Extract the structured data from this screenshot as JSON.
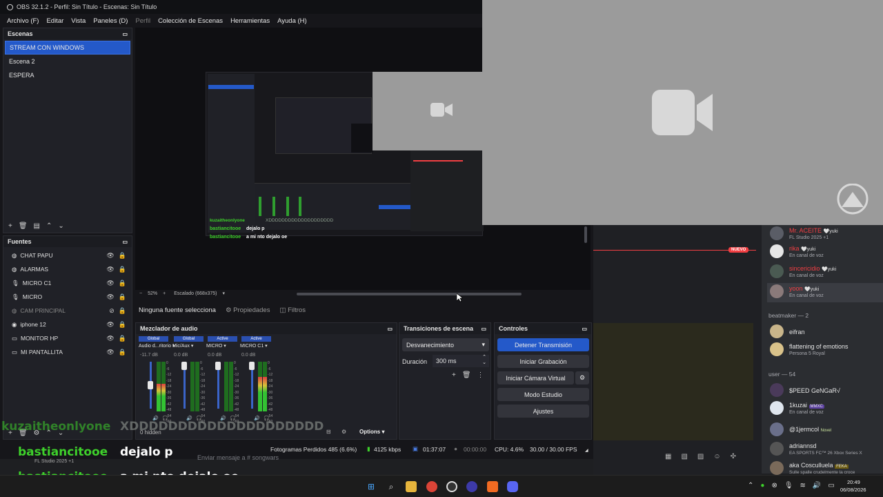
{
  "window": {
    "title": "OBS 32.1.2 - Perfil: Sin Título - Escenas: Sin Título",
    "menu": [
      "Archivo (F)",
      "Editar",
      "Vista",
      "Paneles (D)",
      "Perfil",
      "Colección de Escenas",
      "Herramientas",
      "Ayuda (H)"
    ]
  },
  "scenes": {
    "header": "Escenas",
    "items": [
      "STREAM CON WINDOWS",
      "Escena 2",
      "ESPERA"
    ],
    "selected_index": 0
  },
  "sources": {
    "header": "Fuentes",
    "items": [
      {
        "label": "CHAT PAPU",
        "icon": "browser-icon",
        "hidden": false
      },
      {
        "label": "ALARMAS",
        "icon": "browser-icon",
        "hidden": false
      },
      {
        "label": "MICRO C1",
        "icon": "mic-icon",
        "hidden": false
      },
      {
        "label": "MICRO",
        "icon": "mic-icon",
        "hidden": false
      },
      {
        "label": "CAM PRINCIPAL",
        "icon": "browser-icon",
        "hidden": true
      },
      {
        "label": "iphone 12",
        "icon": "camera-icon",
        "hidden": false
      },
      {
        "label": "MONITOR HP",
        "icon": "monitor-icon",
        "hidden": false
      },
      {
        "label": "MI PANTALLITA",
        "icon": "monitor-icon",
        "hidden": false
      }
    ]
  },
  "preview": {
    "zoom": "52%",
    "scale_label": "Escalado (668x375)",
    "no_source": "Ninguna fuente selecciona",
    "properties": "Propiedades",
    "filters": "Filtros",
    "nested_chat_line1_user": "bastiancitooe",
    "nested_chat_line1_msg": "dejalo p",
    "nested_chat_line2_user": "bastiancitooe",
    "nested_chat_line2_msg": "a mi nto dejalo oe",
    "nested_user_top": "kuzaitheonlyone",
    "nested_top_msg": "XDDDDDDDDDDDDDDDDDDDD"
  },
  "mixer": {
    "header": "Mezclador de audio",
    "channels": [
      {
        "badge": "Global",
        "name": "Audio d...ritorio",
        "db": "-11.7 dB",
        "level": 0.55
      },
      {
        "badge": "Global",
        "name": "Mic/Aux",
        "db": "0.0 dB",
        "level": 0.0
      },
      {
        "badge": "Active",
        "name": "MICRO",
        "db": "0.0 dB",
        "level": 0.0
      },
      {
        "badge": "Active",
        "name": "MICRO C1",
        "db": "0.0 dB",
        "level": 0.7
      }
    ],
    "scale": [
      "0",
      "-6",
      "-12",
      "-18",
      "-24",
      "-30",
      "-36",
      "-42",
      "-48",
      "-54",
      "-60"
    ],
    "hidden_label": "0 hidden",
    "options_label": "Options"
  },
  "transitions": {
    "header": "Transiciones de escena",
    "selected": "Desvanecimiento",
    "duration_label": "Duración",
    "duration_value": "300 ms"
  },
  "controls": {
    "header": "Controles",
    "stop_stream": "Detener Transmisión",
    "start_record": "Iniciar Grabación",
    "virtual_cam": "Iniciar Cámara Virtual",
    "studio_mode": "Modo Estudio",
    "settings": "Ajustes"
  },
  "statusbar": {
    "dropped": "Fotogramas Perdidos 485 (6.6%)",
    "bitrate": "4125 kbps",
    "stream_time": "01:37:07",
    "record_time": "00:00:00",
    "cpu": "CPU: 4.6%",
    "fps": "30.00 / 30.00 FPS"
  },
  "overlay_chat": {
    "user_top": "kuzaitheonlyone",
    "msg_top": "XDDDDDDDDDDDDDDDDDDDD",
    "line1_user": "bastiancitooe",
    "line1_msg": "dejalo p",
    "line2_user": "bastiancitooe",
    "line2_msg": "a mi nto dejalo oe",
    "studio_tag": "FL Studio 2025 +1",
    "input_placeholder": "Enviar mensaje a # songwars"
  },
  "discord": {
    "nuevo_label": "NUEVO",
    "members_top": [
      {
        "name": "Mr. ACEITE",
        "tag": "yuki",
        "sub": "FL Studio 2025 +1"
      },
      {
        "name": "rika",
        "tag": "yuki",
        "sub": "En canal de voz"
      },
      {
        "name": "sincericidio",
        "tag": "yuki",
        "sub": "En canal de voz"
      },
      {
        "name": "yoon",
        "tag": "yuki",
        "sub": "En canal de voz"
      }
    ],
    "group_beatmaker": "beatmaker — 2",
    "beatmakers": [
      {
        "name": "eifran",
        "sub": ""
      },
      {
        "name": "flattening of emotions",
        "sub": "Persona 5 Royal"
      }
    ],
    "group_user": "user — 54",
    "users": [
      {
        "name": "$PEED GeNGaR√",
        "tag": "",
        "sub": ""
      },
      {
        "name": "1kuzai",
        "tag": "MMXC",
        "sub": "En canal de voz"
      },
      {
        "name": "@1jermcol",
        "tag": "Novel",
        "sub": ""
      },
      {
        "name": "adriannsd",
        "tag": "",
        "sub": "EA SPORTS FC™ 26 Xbox Series X"
      },
      {
        "name": "aka Cosculluela",
        "tag": "FEKA",
        "sub": "Sulle spalle crudelmente la croce"
      }
    ]
  },
  "taskbar": {
    "time": "20:49",
    "date": "06/08/2026"
  },
  "colors": {
    "accent": "#2459c9",
    "chat_green": "#3ed12b",
    "discord_red": "#f23f43"
  }
}
